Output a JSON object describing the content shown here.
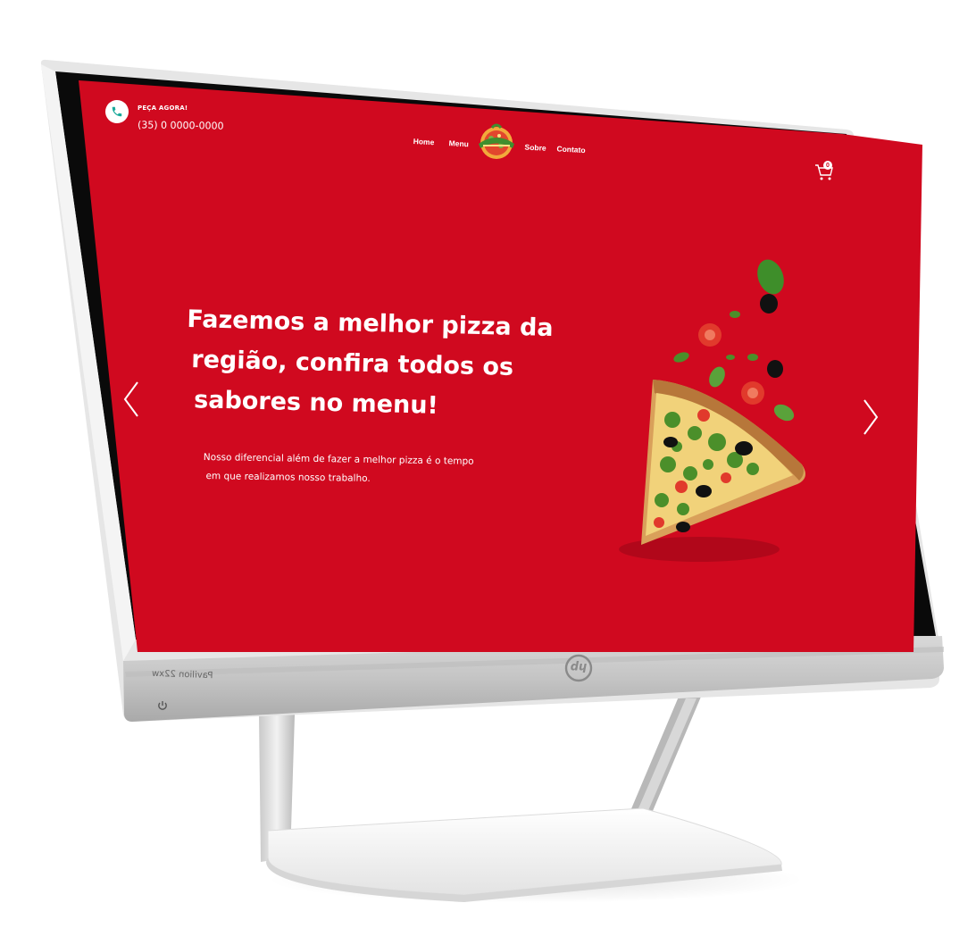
{
  "header": {
    "order_label": "PEÇA AGORA!",
    "phone": "(35) 0 0000-0000",
    "cart_count": "0"
  },
  "nav": {
    "items": [
      "Home",
      "Menu",
      "Sobre",
      "Contato"
    ]
  },
  "hero": {
    "headline_lines": [
      "Fazemos a melhor pizza da",
      "região, confira todos os",
      "sabores no menu!"
    ],
    "subtext_lines": [
      "Nosso diferencial além de fazer a melhor pizza é o tempo",
      "em que realizamos nosso trabalho."
    ]
  },
  "monitor": {
    "model": "Pavilion 22xw",
    "brand": "hp"
  },
  "colors": {
    "brand_red": "#d0091f",
    "phone_icon_teal": "#19a99a",
    "bezel_silver": "#cfcfcf"
  },
  "icons": [
    "phone-icon",
    "cart-icon",
    "chevron-left-icon",
    "chevron-right-icon",
    "power-icon",
    "hp-logo-icon",
    "pizzeria-logo-icon"
  ]
}
